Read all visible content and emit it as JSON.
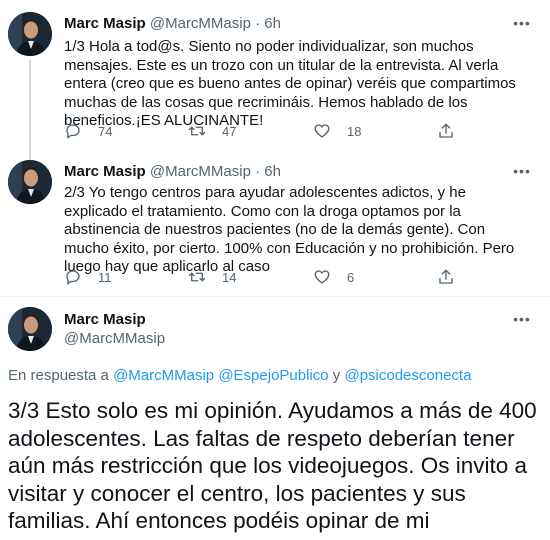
{
  "tweets": [
    {
      "name": "Marc Masip",
      "handle": "@MarcMMasip",
      "separator": "·",
      "time": "6h",
      "text": "1/3 Hola a tod@s. Siento no poder individualizar, son muchos mensajes. Este es un trozo con un titular de la entrevista. Al verla entera (creo que es bueno antes de opinar) veréis que compartimos muchas de las cosas que recrimináis. Hemos hablado de los beneficios.¡ES ALUCINANTE!",
      "replies": "74",
      "retweets": "47",
      "likes": "18"
    },
    {
      "name": "Marc Masip",
      "handle": "@MarcMMasip",
      "separator": "·",
      "time": "6h",
      "text": "2/3 Yo tengo centros para ayudar adolescentes adictos, y he explicado el tratamiento. Como con la droga optamos por la abstinencia de nuestros pacientes (no de la demás gente). Con mucho éxito, por cierto. 100% con Educación y no prohibición. Pero luego hay que aplicarlo al caso",
      "replies": "11",
      "retweets": "14",
      "likes": "6"
    }
  ],
  "main_tweet": {
    "name": "Marc Masip",
    "handle": "@MarcMMasip",
    "reply_prefix": "En respuesta a",
    "mention_1": "@MarcMMasip",
    "mention_2": "@EspejoPublico",
    "reply_conj": "y",
    "mention_3": "@psicodesconecta",
    "text": "3/3 Esto solo es mi opinión. Ayudamos a más de 400 adolescentes. Las faltas de respeto deberían tener aún más restricción que los videojuegos. Os invito a visitar y conocer el centro, los pacientes y sus familias. Ahí entonces podéis opinar de mi profesionalidad."
  },
  "more_label": "•••",
  "icons": [
    "reply-icon",
    "retweet-icon",
    "like-icon",
    "share-icon",
    "more-icon",
    "avatar"
  ],
  "colors": {
    "text": "#0f1419",
    "secondary": "#536471",
    "link": "#1d9bf0",
    "thread_line": "#cfd9de"
  }
}
